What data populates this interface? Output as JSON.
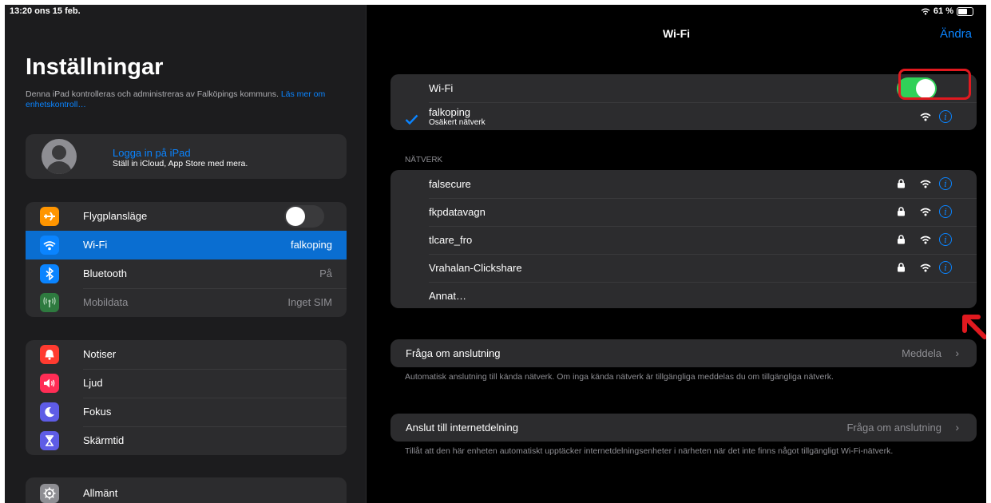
{
  "status_bar": {
    "time_date": "13:20  ons 15 feb.",
    "battery": "61 %"
  },
  "sidebar": {
    "title": "Inställningar",
    "managed_text": "Denna iPad kontrolleras och administreras av Falköpings kommuns.",
    "managed_link": "Läs mer om enhetskontroll…",
    "account": {
      "title": "Logga in på iPad",
      "subtitle": "Ställ in iCloud, App Store med mera."
    },
    "group1": [
      {
        "label": "Flygplansläge",
        "value": "",
        "icon": "airplane-icon",
        "color": "#ff9500"
      },
      {
        "label": "Wi-Fi",
        "value": "falkoping",
        "icon": "wifi-icon",
        "color": "#0a84ff"
      },
      {
        "label": "Bluetooth",
        "value": "På",
        "icon": "bluetooth-icon",
        "color": "#0a84ff"
      },
      {
        "label": "Mobildata",
        "value": "Inget SIM",
        "icon": "antenna-icon",
        "color": "#34c759"
      }
    ],
    "group2": [
      {
        "label": "Notiser",
        "icon": "bell-icon",
        "color": "#ff3b30"
      },
      {
        "label": "Ljud",
        "icon": "speaker-icon",
        "color": "#ff2d55"
      },
      {
        "label": "Fokus",
        "icon": "moon-icon",
        "color": "#5e5ce6"
      },
      {
        "label": "Skärmtid",
        "icon": "hourglass-icon",
        "color": "#5e5ce6"
      }
    ],
    "group3": [
      {
        "label": "Allmänt",
        "icon": "gear-icon",
        "color": "#8e8e93"
      }
    ]
  },
  "detail": {
    "nav_title": "Wi-Fi",
    "edit_label": "Ändra",
    "wifi_label": "Wi-Fi",
    "wifi_on": true,
    "connected": {
      "name": "falkoping",
      "subtitle": "Osäkert nätverk"
    },
    "networks_header": "NÄTVERK",
    "networks": [
      "falsecure",
      "fkpdatavagn",
      "tlcare_fro",
      "Vrahalan-Clickshare"
    ],
    "other_label": "Annat…",
    "ask_join": {
      "label": "Fråga om anslutning",
      "value": "Meddela",
      "footer": "Automatisk anslutning till kända nätverk. Om inga kända nätverk är tillgängliga meddelas du om tillgängliga nätverk."
    },
    "hotspot": {
      "label": "Anslut till internetdelning",
      "value": "Fråga om anslutning",
      "footer": "Tillåt att den här enheten automatiskt upptäcker internetdelningsenheter i närheten när det inte finns något tillgängligt Wi-Fi-nätverk."
    }
  },
  "colors": {
    "accent": "#0a84ff",
    "toggle_on": "#30d158",
    "annotation": "#e0191f"
  }
}
